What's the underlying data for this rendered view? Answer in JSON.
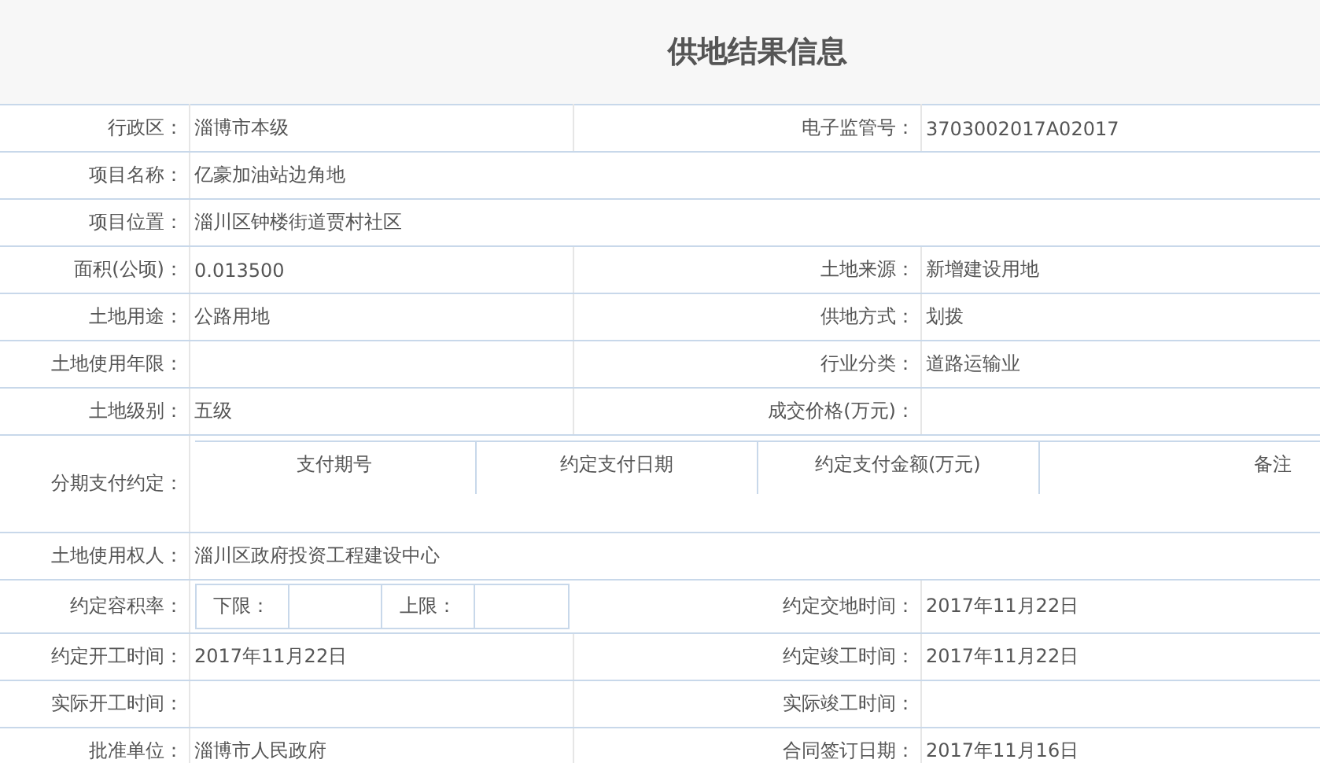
{
  "title": "供地结果信息",
  "rows": [
    {
      "kind": "pair",
      "left": {
        "label": "行政区：",
        "value": "淄博市本级"
      },
      "right": {
        "label": "电子监管号：",
        "value": "3703002017A02017"
      }
    },
    {
      "kind": "wide",
      "label": "项目名称：",
      "value": "亿豪加油站边角地"
    },
    {
      "kind": "wide",
      "label": "项目位置：",
      "value": "淄川区钟楼街道贾村社区"
    },
    {
      "kind": "pair",
      "left": {
        "label": "面积(公顷)：",
        "value": "0.013500"
      },
      "right": {
        "label": "土地来源：",
        "value": "新增建设用地"
      }
    },
    {
      "kind": "pair",
      "left": {
        "label": "土地用途：",
        "value": "公路用地"
      },
      "right": {
        "label": "供地方式：",
        "value": "划拨"
      }
    },
    {
      "kind": "pair",
      "left": {
        "label": "土地使用年限："
      },
      "right": {
        "label": "行业分类：",
        "value": "道路运输业"
      }
    },
    {
      "kind": "pair",
      "left": {
        "label": "土地级别：",
        "value": "五级"
      },
      "right": {
        "label": "成交价格(万元)："
      }
    },
    {
      "kind": "installments",
      "label": "分期支付约定：",
      "columns": [
        "支付期号",
        "约定支付日期",
        "约定支付金额(万元)",
        "备注"
      ]
    },
    {
      "kind": "wide",
      "label": "土地使用权人：",
      "value": "淄川区政府投资工程建设中心"
    },
    {
      "kind": "range",
      "label": "约定容积率：",
      "lower_label": "下限：",
      "upper_label": "上限：",
      "right": {
        "label": "约定交地时间：",
        "value": "2017年11月22日"
      }
    },
    {
      "kind": "pair",
      "left": {
        "label": "约定开工时间：",
        "value": "2017年11月22日"
      },
      "right": {
        "label": "约定竣工时间：",
        "value": "2017年11月22日"
      }
    },
    {
      "kind": "pair",
      "left": {
        "label": "实际开工时间："
      },
      "right": {
        "label": "实际竣工时间："
      }
    },
    {
      "kind": "pair",
      "left": {
        "label": "批准单位：",
        "value": "淄博市人民政府"
      },
      "right": {
        "label": "合同签订日期：",
        "value": "2017年11月16日"
      }
    }
  ]
}
